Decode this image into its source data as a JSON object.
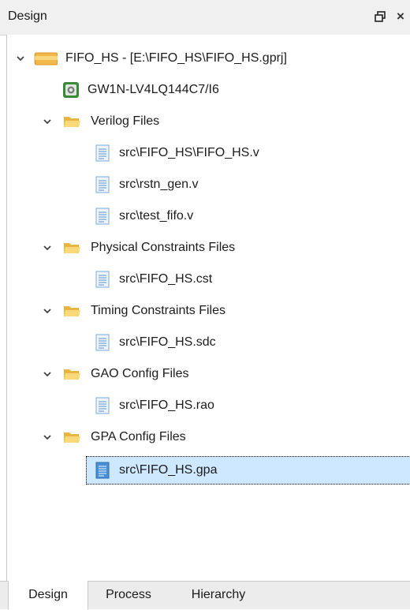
{
  "panel": {
    "title": "Design",
    "float_glyph": "🗗",
    "close_glyph": "×"
  },
  "tree": {
    "project": {
      "label": "FIFO_HS - [E:\\FIFO_HS\\FIFO_HS.gprj]",
      "device": "GW1N-LV4LQ144C7/I6"
    },
    "groups": [
      {
        "label": "Verilog Files",
        "files": [
          "src\\FIFO_HS\\FIFO_HS.v",
          "src\\rstn_gen.v",
          "src\\test_fifo.v"
        ]
      },
      {
        "label": "Physical Constraints Files",
        "files": [
          "src\\FIFO_HS.cst"
        ]
      },
      {
        "label": "Timing Constraints Files",
        "files": [
          "src\\FIFO_HS.sdc"
        ]
      },
      {
        "label": "GAO Config Files",
        "files": [
          "src\\FIFO_HS.rao"
        ]
      },
      {
        "label": "GPA Config Files",
        "files": [
          "src\\FIFO_HS.gpa"
        ]
      }
    ],
    "selected_file": "src\\FIFO_HS.gpa"
  },
  "tabs": [
    "Design",
    "Process",
    "Hierarchy"
  ],
  "active_tab": "Design",
  "colors": {
    "selection": "#cde8ff",
    "folder": "#f6c758",
    "file": "#4a8fd6"
  }
}
